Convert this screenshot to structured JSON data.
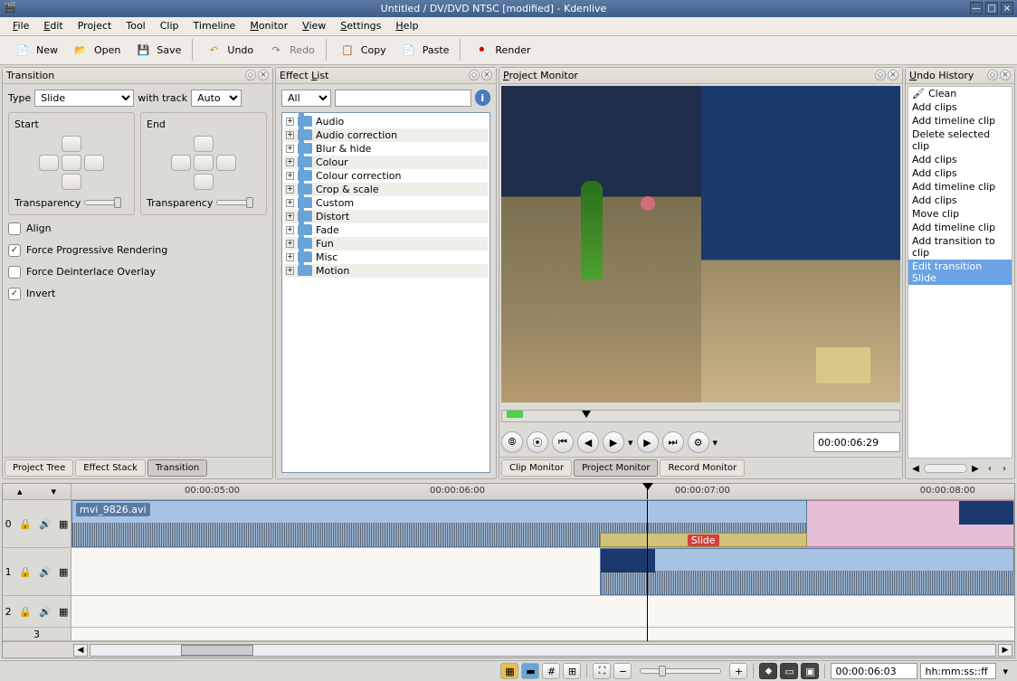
{
  "window": {
    "title": "Untitled / DV/DVD NTSC [modified] - Kdenlive"
  },
  "menu": {
    "file": "File",
    "edit": "Edit",
    "project": "Project",
    "tool": "Tool",
    "clip": "Clip",
    "timeline": "Timeline",
    "monitor": "Monitor",
    "view": "View",
    "settings": "Settings",
    "help": "Help"
  },
  "toolbar": {
    "new": "New",
    "open": "Open",
    "save": "Save",
    "undo": "Undo",
    "redo": "Redo",
    "copy": "Copy",
    "paste": "Paste",
    "render": "Render"
  },
  "transition": {
    "title": "Transition",
    "type_label": "Type",
    "type_value": "Slide",
    "track_label": "with track",
    "track_value": "Auto",
    "start_label": "Start",
    "end_label": "End",
    "transp_label": "Transparency",
    "align": "Align",
    "force_progressive": "Force Progressive Rendering",
    "force_deinterlace": "Force Deinterlace Overlay",
    "invert": "Invert",
    "tabs": {
      "project_tree": "Project Tree",
      "effect_stack": "Effect Stack",
      "transition": "Transition"
    }
  },
  "effects": {
    "title": "Effect List",
    "filter_value": "All",
    "categories": [
      "Audio",
      "Audio correction",
      "Blur & hide",
      "Colour",
      "Colour correction",
      "Crop & scale",
      "Custom",
      "Distort",
      "Fade",
      "Fun",
      "Misc",
      "Motion"
    ]
  },
  "monitor": {
    "title": "Project Monitor",
    "timecode": "00:00:06:29",
    "tabs": {
      "clip": "Clip Monitor",
      "project": "Project Monitor",
      "record": "Record Monitor"
    }
  },
  "history": {
    "title": "Undo History",
    "items": [
      "Clean",
      "Add clips",
      "Add timeline clip",
      "Delete selected clip",
      "Add clips",
      "Add clips",
      "Add timeline clip",
      "Add clips",
      "Move clip",
      "Add timeline clip",
      "Add transition to clip",
      "Edit transition Slide"
    ],
    "selected_index": 11
  },
  "timeline": {
    "timecodes": [
      "00:00:05:00",
      "00:00:06:00",
      "00:00:07:00",
      "00:00:08:00"
    ],
    "clip_name": "mvi_9826.avi",
    "transition_label": "Slide",
    "tracks": [
      "0",
      "1",
      "2",
      "3"
    ]
  },
  "status": {
    "time": "00:00:06:03",
    "format": "hh:mm:ss::ff"
  }
}
